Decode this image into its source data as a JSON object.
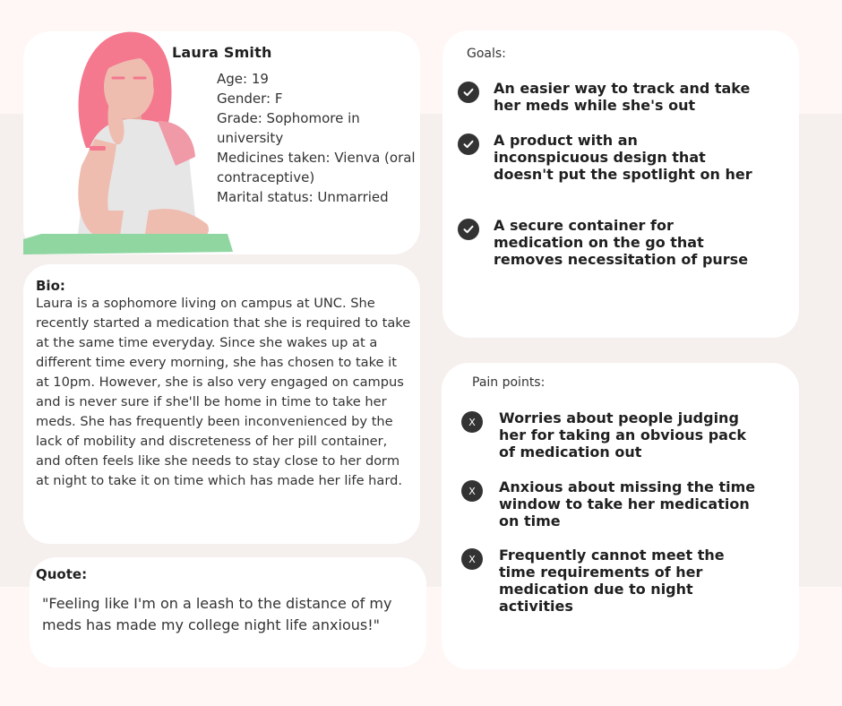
{
  "profile": {
    "name": "Laura Smith",
    "details": [
      "Age: 19",
      "Gender: F",
      "Grade: Sophomore in university",
      "Medicines taken: Vienva (oral contraceptive)",
      "Marital status: Unmarried"
    ]
  },
  "bio": {
    "label": "Bio:",
    "text": "Laura is a sophomore living on campus at UNC. She recently started a medication that she is required to take at the same time everyday. Since she wakes up at a different time every morning, she has chosen to take it at 10pm. However, she is also very engaged on campus and is never sure if she'll be home in time to take her meds. She has frequently been inconvenienced by the lack of mobility and discreteness of her pill container, and often feels like she needs to stay close to her dorm at night to take it on time which has made her life hard."
  },
  "quote": {
    "label": "Quote:",
    "text": "\"Feeling like I'm on a leash to the distance of my meds has made my college night life anxious!\""
  },
  "goals": {
    "title": "Goals:",
    "items": [
      "An easier way to track and take her meds while she's out",
      "A product with an inconspicuous design that doesn't put the spotlight on her",
      "A secure container for medication on the go that removes necessitation of purse"
    ]
  },
  "pain_points": {
    "title": "Pain points:",
    "badge": "X",
    "items": [
      "Worries about people judging her for taking an obvious pack of medication out",
      "Anxious about missing the time window to take her medication on time",
      "Frequently cannot meet the time requirements of her medication due to night activities"
    ]
  },
  "colors": {
    "background": "#fef7f5",
    "band": "#f5efed",
    "card": "#ffffff",
    "hair": "#f4788e",
    "skin": "#efbcb0",
    "shirt": "#e6e6e6",
    "table": "#8fd6a0",
    "badge": "#333333"
  },
  "icons": {
    "goal_badge": "check-circle-icon",
    "pain_badge": "x-circle-icon"
  }
}
